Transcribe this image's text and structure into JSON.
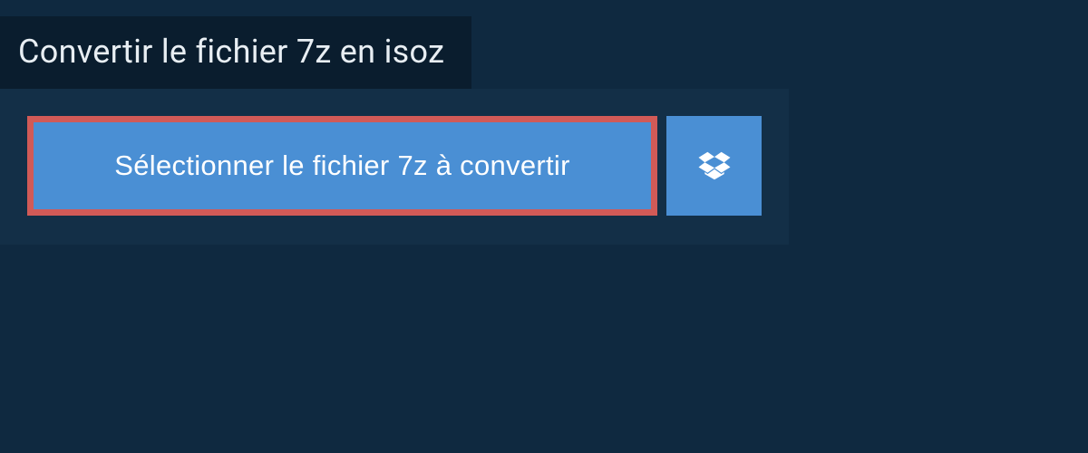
{
  "header": {
    "title": "Convertir le fichier 7z en isoz"
  },
  "upload": {
    "select_button_label": "Sélectionner le fichier 7z à convertir"
  },
  "colors": {
    "page_bg": "#0f2940",
    "title_bg": "#0a1d2e",
    "panel_bg": "#132f47",
    "button_bg": "#4a8fd4",
    "highlight_border": "#d15a57",
    "text_light": "#e8eef3"
  }
}
